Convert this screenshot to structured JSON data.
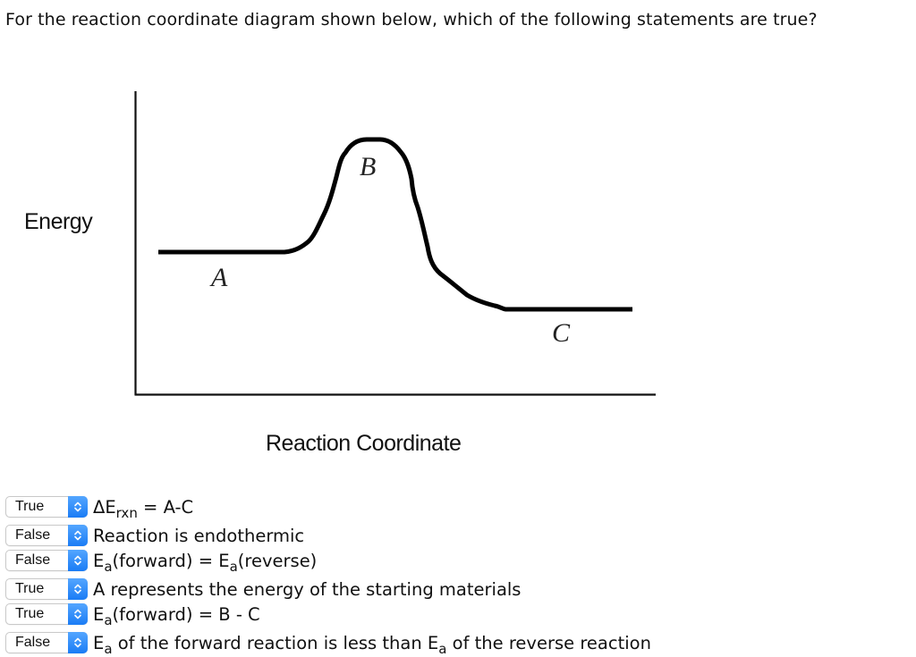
{
  "question": "For the reaction coordinate diagram shown below, which of the following statements are true?",
  "diagram": {
    "y_axis_label": "Energy",
    "x_axis_label": "Reaction Coordinate",
    "points": {
      "A": "A",
      "B": "B",
      "C": "C"
    },
    "description": "Energy profile: reactants at A, transition state peak at B, products at C lower than A (exothermic)"
  },
  "statements": [
    {
      "selected": "True",
      "parts": [
        {
          "t": "ΔE"
        },
        {
          "sub": "rxn"
        },
        {
          "t": " = A-C"
        }
      ]
    },
    {
      "selected": "False",
      "parts": [
        {
          "t": "Reaction is endothermic"
        }
      ]
    },
    {
      "selected": "False",
      "parts": [
        {
          "t": "E"
        },
        {
          "sub": "a"
        },
        {
          "t": "(forward) = E"
        },
        {
          "sub": "a"
        },
        {
          "t": "(reverse)"
        }
      ]
    },
    {
      "selected": "True",
      "parts": [
        {
          "t": "A represents the energy of the starting materials"
        }
      ]
    },
    {
      "selected": "True",
      "parts": [
        {
          "t": "E"
        },
        {
          "sub": "a"
        },
        {
          "t": "(forward) = B - C"
        }
      ]
    },
    {
      "selected": "False",
      "parts": [
        {
          "t": "E"
        },
        {
          "sub": "a"
        },
        {
          "t": " of the forward reaction is less than E"
        },
        {
          "sub": "a"
        },
        {
          "t": " of the reverse reaction"
        }
      ]
    }
  ],
  "select_options_visible": [
    "True",
    "False"
  ],
  "colors": {
    "select_accent": "#1a7cf5",
    "text": "#111111"
  }
}
